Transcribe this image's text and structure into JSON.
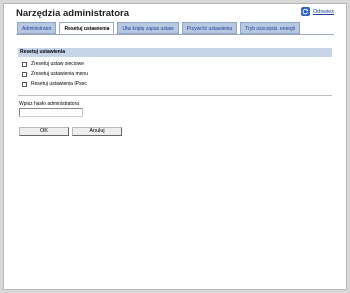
{
  "page": {
    "title": "Narzędzia administratora",
    "refresh_label": "Odśwież"
  },
  "tabs": [
    {
      "label": "Administrator",
      "active": false
    },
    {
      "label": "Resetuj ustawienia",
      "active": true
    },
    {
      "label": "Utw kopię zapas ustaw",
      "active": false
    },
    {
      "label": "Przywróć ustawienia",
      "active": false
    },
    {
      "label": "Tryb oszczędz. energii",
      "active": false
    }
  ],
  "reset_section": {
    "header": "Resetuj ustawienia",
    "options": [
      {
        "label": "Zresetuj ustaw sieciowe",
        "checked": false
      },
      {
        "label": "Zresetuj ustawienia menu",
        "checked": false
      },
      {
        "label": "Resetuj ustawienia IPsec",
        "checked": false
      }
    ]
  },
  "password": {
    "label": "Wpisz hasło administratora",
    "value": "",
    "placeholder": ""
  },
  "buttons": {
    "ok_label": "OK",
    "cancel_label": "Anuluj"
  },
  "icons": {
    "refresh": "refresh-icon"
  },
  "colors": {
    "tab_bg": "#b8c8e0",
    "tab_text": "#1c3fa0",
    "section_header_bg": "#c8d4e8",
    "refresh_icon": "#2a62c8"
  }
}
